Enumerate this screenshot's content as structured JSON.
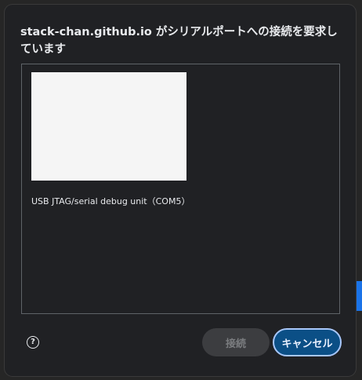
{
  "dialog": {
    "title": "stack-chan.github.io がシリアルポートへの接続を要求しています"
  },
  "devices": [
    {
      "label": "USB JTAG/serial debug unit（COM5）"
    }
  ],
  "buttons": {
    "connect": "接続",
    "cancel": "キャンセル"
  },
  "help": {
    "icon": "help-icon",
    "glyph": "?"
  },
  "colors": {
    "dialog_bg": "#202124",
    "cancel_bg": "#0b4f86",
    "cancel_border": "#a8c7fa",
    "connect_bg": "#3c3d40"
  }
}
